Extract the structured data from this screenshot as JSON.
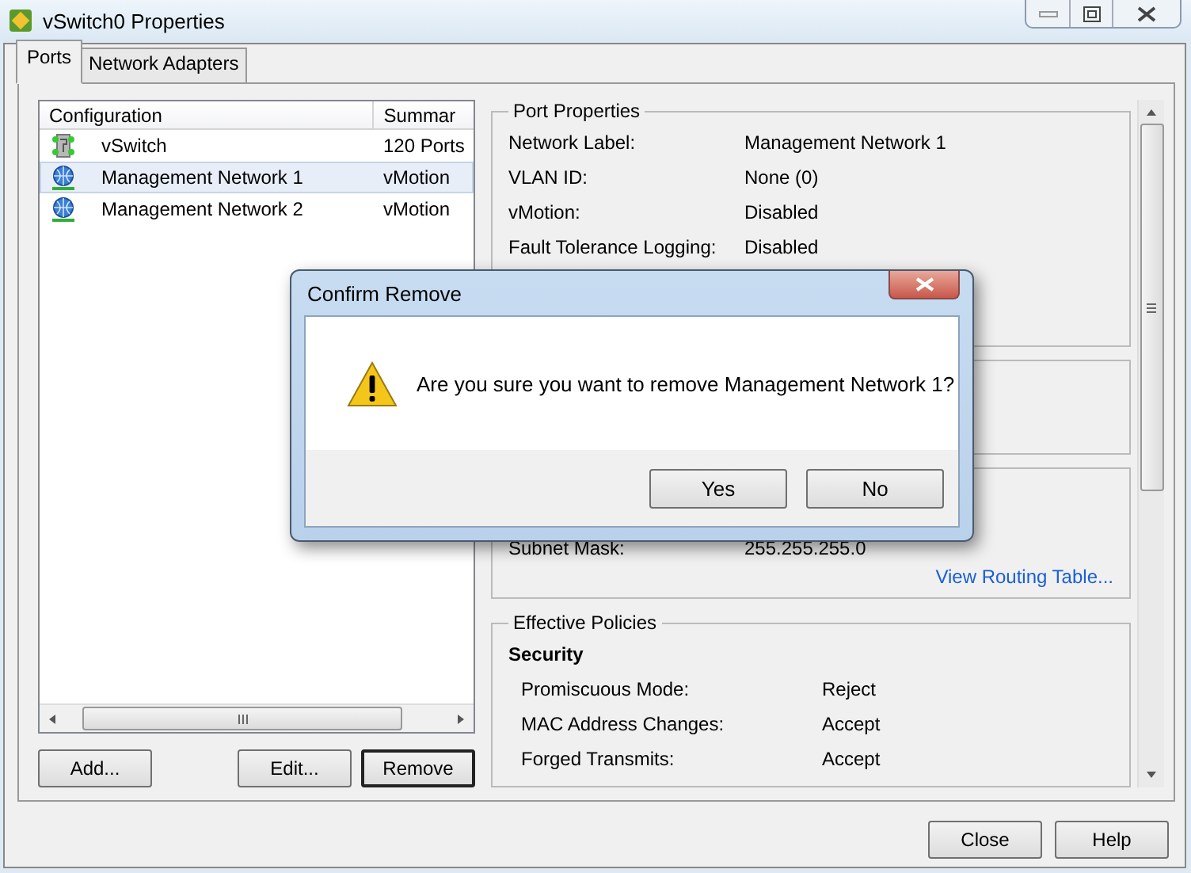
{
  "window": {
    "title": "vSwitch0 Properties"
  },
  "tabs": [
    {
      "label": "Ports",
      "selected": true
    },
    {
      "label": "Network Adapters",
      "selected": false
    }
  ],
  "config_list": {
    "columns": [
      "Configuration",
      "Summar"
    ],
    "rows": [
      {
        "kind": "switch",
        "name": "vSwitch",
        "summary": "120 Ports",
        "selected": false
      },
      {
        "kind": "network",
        "name": "Management Network 1",
        "summary": "vMotion",
        "selected": true
      },
      {
        "kind": "network",
        "name": "Management Network 2",
        "summary": "vMotion",
        "selected": false
      }
    ],
    "buttons": [
      {
        "label": "Add...",
        "focused": false
      },
      {
        "label": "Edit...",
        "focused": false
      },
      {
        "label": "Remove",
        "focused": true
      }
    ]
  },
  "port_properties": {
    "title": "Port Properties",
    "rows": [
      {
        "label": "Network Label:",
        "value": "Management Network 1"
      },
      {
        "label": "VLAN ID:",
        "value": "None (0)"
      },
      {
        "label": "vMotion:",
        "value": "Disabled"
      },
      {
        "label": "Fault Tolerance Logging:",
        "value": "Disabled"
      }
    ]
  },
  "ip_settings": {
    "rows": [
      {
        "label": "Subnet Mask:",
        "value": "255.255.255.0"
      }
    ],
    "link": "View Routing Table..."
  },
  "effective_policies": {
    "title": "Effective Policies",
    "section": "Security",
    "rows": [
      {
        "label": "Promiscuous Mode:",
        "value": "Reject"
      },
      {
        "label": "MAC Address Changes:",
        "value": "Accept"
      },
      {
        "label": "Forged Transmits:",
        "value": "Accept"
      }
    ]
  },
  "footer_buttons": [
    "Close",
    "Help"
  ],
  "dialog": {
    "title": "Confirm Remove",
    "message": "Are you sure you want to remove Management Network 1?",
    "buttons": [
      "Yes",
      "No"
    ]
  }
}
